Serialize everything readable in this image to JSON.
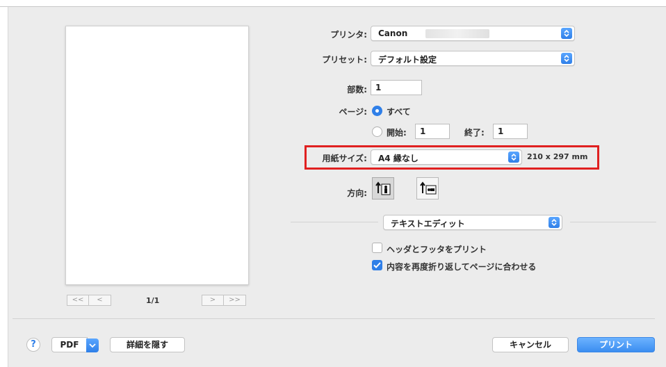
{
  "printer": {
    "label": "プリンタ:",
    "value": "Canon"
  },
  "preset": {
    "label": "プリセット:",
    "value": "デフォルト設定"
  },
  "copies": {
    "label": "部数:",
    "value": "1"
  },
  "pages": {
    "label": "ページ:",
    "all_label": "すべて",
    "from_label": "開始:",
    "from_value": "1",
    "to_label": "終了:",
    "to_value": "1"
  },
  "paper_size": {
    "label": "用紙サイズ:",
    "value": "A4 縁なし",
    "dimensions": "210 x 297 mm"
  },
  "orientation": {
    "label": "方向:"
  },
  "app_menu": {
    "value": "テキストエディット"
  },
  "options": {
    "header_footer": {
      "label": "ヘッダとフッタをプリント",
      "checked": false
    },
    "rewrap": {
      "label": "内容を再度折り返してページに合わせる",
      "checked": true
    }
  },
  "preview": {
    "first_label": "<<",
    "prev_label": "<",
    "next_label": ">",
    "last_label": ">>",
    "page_indicator": "1/1"
  },
  "footer": {
    "help_label": "?",
    "pdf_label": "PDF",
    "hide_details_label": "詳細を隠す",
    "cancel_label": "キャンセル",
    "print_label": "プリント"
  },
  "colors": {
    "accent": "#2f7fe8",
    "highlight": "#e02020"
  }
}
